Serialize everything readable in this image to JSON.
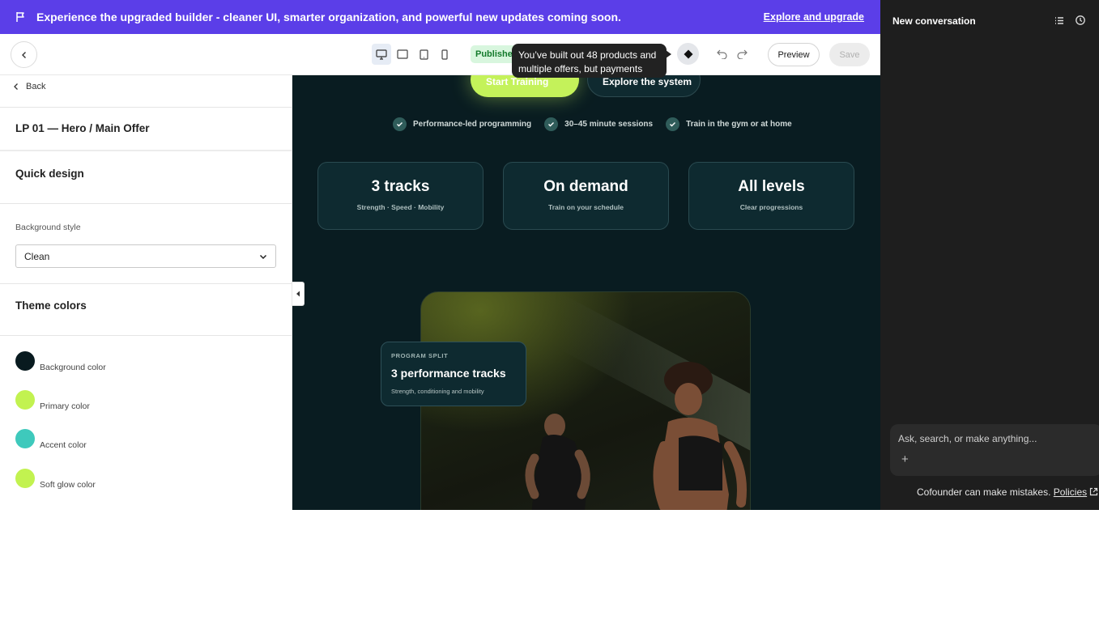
{
  "banner": {
    "message": "Experience the upgraded builder - cleaner UI, smarter organization, and powerful new updates coming soon.",
    "link": "Explore and upgrade"
  },
  "toolbar": {
    "status_badge": "Published",
    "tooltip": "You’ve built out 48 products and multiple offers, but payments",
    "preview": "Preview",
    "save": "Save"
  },
  "left_panel": {
    "back": "Back",
    "page_title": "LP 01 — Hero / Main Offer",
    "quick_design": "Quick design",
    "background_style_label": "Background style",
    "background_style_value": "Clean",
    "theme_colors": "Theme colors",
    "colors": [
      {
        "label": "Background color",
        "color": "#081a1f"
      },
      {
        "label": "Primary color",
        "color": "#c2f250"
      },
      {
        "label": "Accent color",
        "color": "#3ec9bc"
      },
      {
        "label": "Soft glow color",
        "color": "#c2f250"
      }
    ]
  },
  "canvas": {
    "cta_primary": "Start Training",
    "cta_secondary": "Explore the system",
    "bullets": [
      "Performance-led programming",
      "30–45 minute sessions",
      "Train in the gym or at home"
    ],
    "stats": [
      {
        "big": "3 tracks",
        "small": "Strength · Speed · Mobility"
      },
      {
        "big": "On demand",
        "small": "Train on your schedule"
      },
      {
        "big": "All levels",
        "small": "Clear progressions"
      }
    ],
    "program_card": {
      "kicker": "PROGRAM SPLIT",
      "headline": "3 performance tracks",
      "sub": "Strength, conditioning and mobility"
    }
  },
  "chat": {
    "title": "New conversation",
    "input_placeholder": "Ask, search, or make anything...",
    "disclaimer": "Cofounder can make mistakes.",
    "policies": "Policies"
  }
}
